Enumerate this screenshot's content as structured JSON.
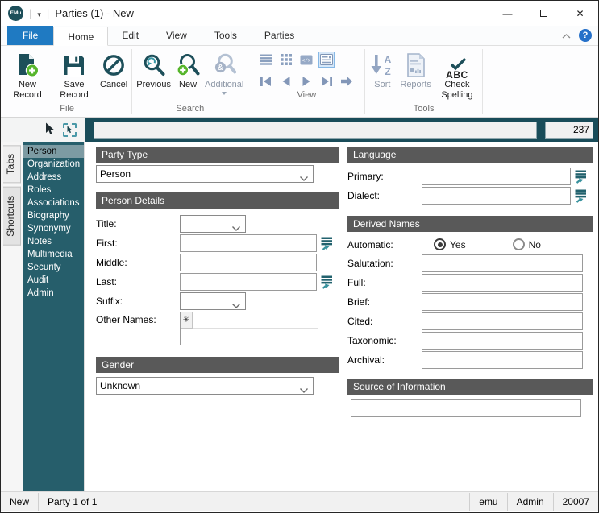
{
  "window": {
    "logo_text": "EMu",
    "title": "Parties (1) - New",
    "minimize_glyph": "—",
    "close_glyph": "✕",
    "collapse_glyph": "⌃",
    "help_glyph": "?",
    "qat_arrow_glyph": "▾"
  },
  "ribbon_tabs": {
    "file": "File",
    "home": "Home",
    "edit": "Edit",
    "view": "View",
    "tools": "Tools",
    "parties": "Parties"
  },
  "ribbon": {
    "file_group": {
      "caption": "File",
      "new_record": "New Record",
      "save_record": "Save Record",
      "cancel": "Cancel"
    },
    "search_group": {
      "caption": "Search",
      "previous": "Previous",
      "new": "New",
      "additional": "Additional"
    },
    "view_group": {
      "caption": "View"
    },
    "tools_group": {
      "caption": "Tools",
      "sort": "Sort",
      "reports": "Reports",
      "check_spelling": "Check Spelling",
      "abc_text": "ABC"
    }
  },
  "summary_bar": {
    "record_count": "237"
  },
  "side_tabs": {
    "tabs": "Tabs",
    "shortcuts": "Shortcuts"
  },
  "sidebar": {
    "selected": "Person",
    "items": [
      "Person",
      "Organization",
      "Address",
      "Roles",
      "Associations",
      "Biography",
      "Synonymy",
      "Notes",
      "Multimedia",
      "Security",
      "Audit",
      "Admin"
    ]
  },
  "form": {
    "party_type": {
      "header": "Party Type",
      "value": "Person"
    },
    "person_details": {
      "header": "Person Details",
      "title_label": "Title:",
      "first_label": "First:",
      "middle_label": "Middle:",
      "last_label": "Last:",
      "suffix_label": "Suffix:",
      "other_names_label": "Other Names:",
      "grid_new_row_marker": "✳"
    },
    "gender": {
      "header": "Gender",
      "value": "Unknown"
    },
    "language": {
      "header": "Language",
      "primary_label": "Primary:",
      "dialect_label": "Dialect:"
    },
    "derived_names": {
      "header": "Derived Names",
      "automatic_label": "Automatic:",
      "yes_label": "Yes",
      "no_label": "No",
      "automatic_value": "Yes",
      "salutation_label": "Salutation:",
      "full_label": "Full:",
      "brief_label": "Brief:",
      "cited_label": "Cited:",
      "taxonomic_label": "Taxonomic:",
      "archival_label": "Archival:"
    },
    "source": {
      "header": "Source of Information"
    }
  },
  "status_bar": {
    "mode": "New",
    "record_position": "Party 1 of 1",
    "database": "emu",
    "user": "Admin",
    "port": "20007"
  }
}
